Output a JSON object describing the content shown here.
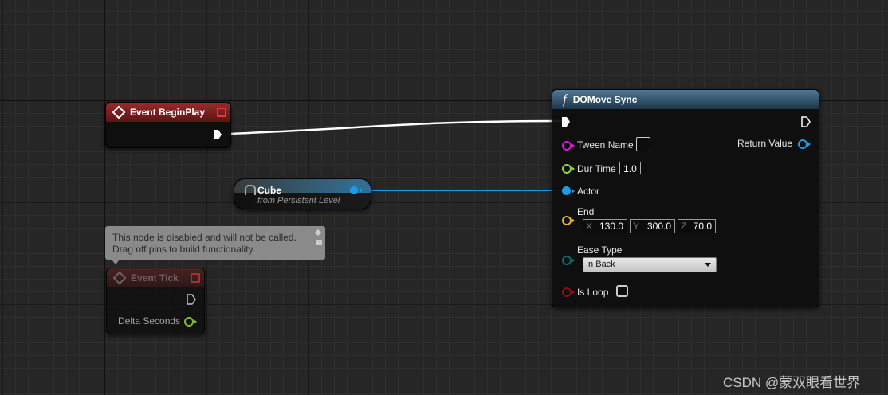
{
  "nodes": {
    "begin_play": {
      "title": "Event BeginPlay"
    },
    "cube": {
      "title": "Cube",
      "subtitle": "from Persistent Level"
    },
    "tooltip": {
      "line1": "This node is disabled and will not be called.",
      "line2": "Drag off pins to build functionality."
    },
    "event_tick": {
      "title": "Event Tick",
      "delta_label": "Delta Seconds"
    },
    "domove": {
      "title": "DOMove Sync",
      "func_glyph": "f",
      "tween_name": "Tween Name",
      "return_value": "Return Value",
      "dur_time": "Dur Time",
      "dur_value": "1.0",
      "actor": "Actor",
      "end": "End",
      "end_x_label": "X",
      "end_x": "130.0",
      "end_y_label": "Y",
      "end_y": "300.0",
      "end_z_label": "Z",
      "end_z": "70.0",
      "ease_type": "Ease Type",
      "ease_value": "In Back",
      "is_loop": "Is Loop"
    }
  },
  "watermark": "CSDN @蒙双眼看世界",
  "colors": {
    "exec_wire": "#ffffff",
    "object_pin": "#1b9be8",
    "string_pin": "#d21ed2",
    "float_pin": "#8ed63b",
    "vector_pin": "#e2b634",
    "enum_pin": "#0f6b6b",
    "bool_pin": "#8a1010"
  }
}
